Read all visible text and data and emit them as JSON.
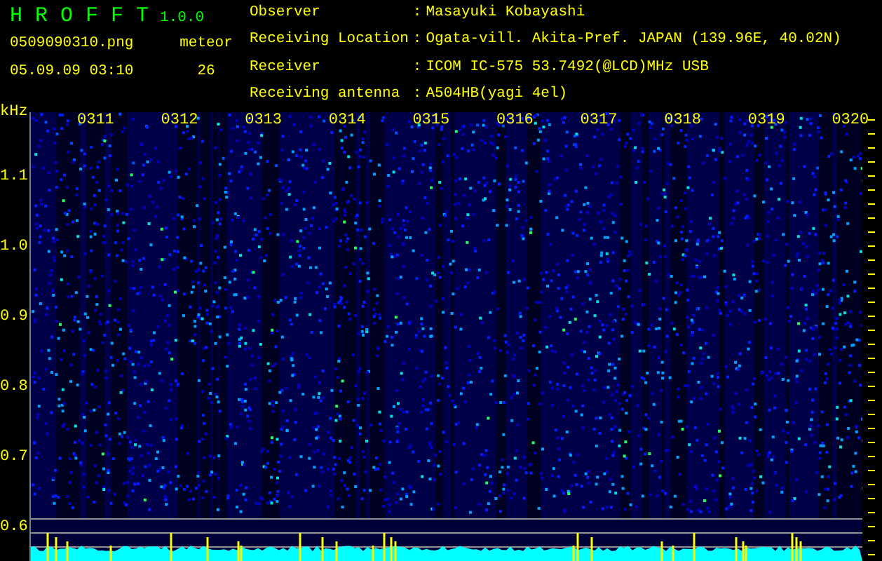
{
  "app": {
    "title": "H R O F F T",
    "version": "1.0.0",
    "filename": "0509090310.png",
    "datetime": "05.09.09 03:10",
    "meteor_label": "meteor",
    "meteor_count": "26"
  },
  "info": [
    {
      "label": "Observer",
      "separator": ":",
      "value": "Masayuki Kobayashi"
    },
    {
      "label": "Receiving Location",
      "separator": ":",
      "value": "Ogata-vill. Akita-Pref. JAPAN (139.96E, 40.02N)"
    },
    {
      "label": "Receiver",
      "separator": ":",
      "value": "ICOM IC-575 53.7492(@LCD)MHz USB"
    },
    {
      "label": "Receiving antenna",
      "separator": ":",
      "value": "A504HB(yagi 4el)"
    }
  ],
  "plot": {
    "unit": "kHz",
    "y_ticks": [
      "1.1",
      "1.0",
      "0.9",
      "0.8",
      "0.7",
      "0.6"
    ],
    "time_labels": [
      "0311",
      "0312",
      "0313",
      "0314",
      "0315",
      "0316",
      "0317",
      "0318",
      "0319",
      "0320"
    ]
  }
}
